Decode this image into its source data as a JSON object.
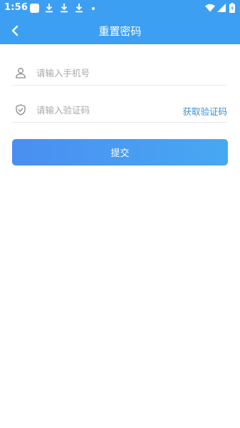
{
  "status_bar": {
    "time": "1:56",
    "icons": [
      "app-notification-icon",
      "download-icon",
      "download-icon",
      "download-icon",
      "dot-icon",
      "wifi-icon",
      "signal-icon",
      "battery-icon"
    ]
  },
  "header": {
    "title": "重置密码",
    "back_icon": "chevron-left-icon",
    "background_color": "#3d9ff2"
  },
  "form": {
    "phone": {
      "placeholder": "请输入手机号",
      "value": "",
      "icon": "user-icon"
    },
    "code": {
      "placeholder": "请输入验证码",
      "value": "",
      "icon": "shield-check-icon",
      "get_code_label": "获取验证码"
    },
    "submit_label": "提交"
  },
  "colors": {
    "accent": "#3d9ff2",
    "link": "#3d8fd8",
    "button_gradient_start": "#4a8ef1",
    "button_gradient_end": "#47a8f2"
  }
}
